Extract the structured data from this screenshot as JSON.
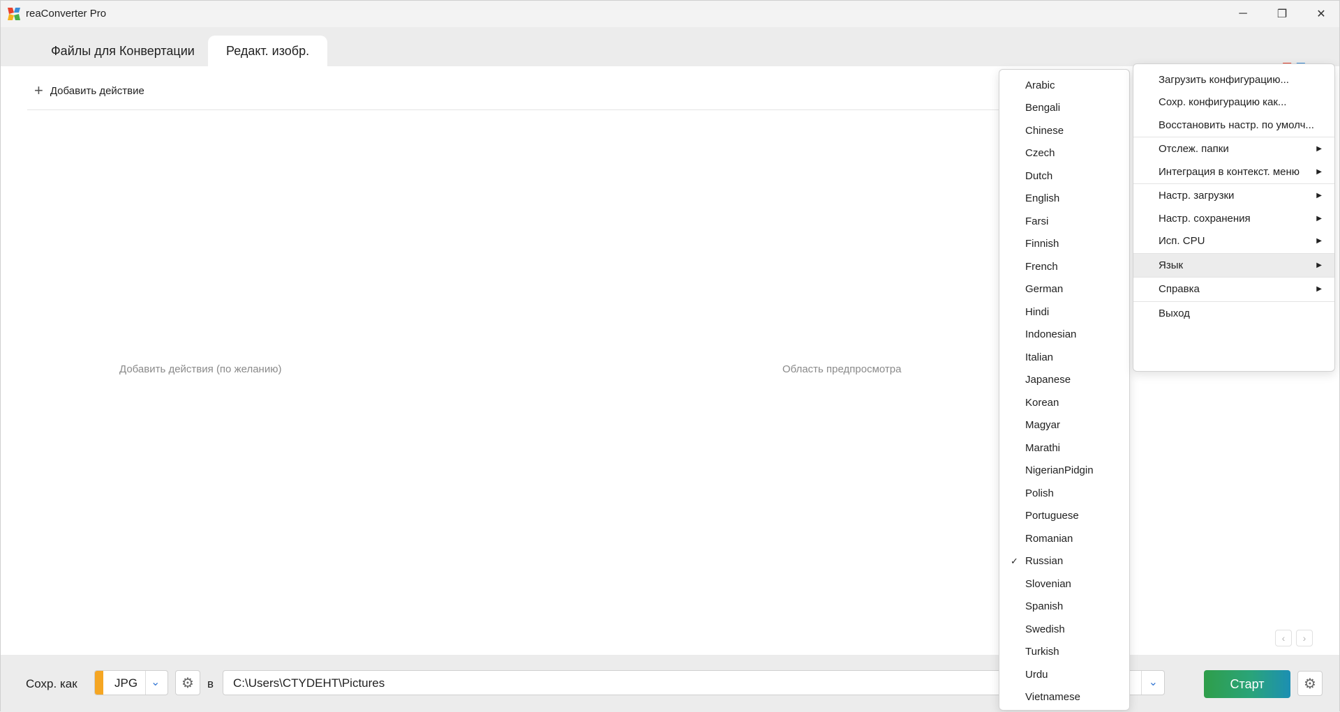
{
  "window": {
    "title": "reaConverter Pro",
    "minimize": "─",
    "maximize": "❐",
    "close": "✕"
  },
  "tabs": [
    {
      "label": "Файлы для Конвертации",
      "active": false
    },
    {
      "label": "Редакт. изобр.",
      "active": true
    }
  ],
  "main": {
    "add_action": "Добавить действие",
    "add_icon": "+",
    "actions_placeholder": "Добавить действия (по желанию)",
    "preview_placeholder": "Область предпросмотра",
    "prev_arrow": "‹",
    "next_arrow": "›"
  },
  "bottom": {
    "save_as_label": "Сохр. как",
    "format": "JPG",
    "format_color": "#f5a623",
    "dropdown_chevron": "⌄",
    "to_label": "в",
    "path": "C:\\Users\\CTYDEHT\\Pictures",
    "start": "Старт",
    "gear": "⚙"
  },
  "menu": {
    "items": [
      {
        "label": "Загрузить конфигурацию...",
        "submenu": false
      },
      {
        "label": "Сохр. конфигурацию как...",
        "submenu": false
      },
      {
        "label": "Восстановить настр. по умолч...",
        "submenu": false
      },
      {
        "label": "Отслеж. папки",
        "submenu": true
      },
      {
        "label": "Интеграция в контекст. меню",
        "submenu": true
      },
      {
        "label": "Настр. загрузки",
        "submenu": true
      },
      {
        "label": "Настр. сохранения",
        "submenu": true
      },
      {
        "label": "Исп. CPU",
        "submenu": true
      },
      {
        "label": "Язык",
        "submenu": true
      },
      {
        "label": "Справка",
        "submenu": true
      },
      {
        "label": "Выход",
        "submenu": false
      }
    ],
    "arrow": "▶"
  },
  "languages": {
    "selected": "Russian",
    "check": "✓",
    "items": [
      "Arabic",
      "Bengali",
      "Chinese",
      "Czech",
      "Dutch",
      "English",
      "Farsi",
      "Finnish",
      "French",
      "German",
      "Hindi",
      "Indonesian",
      "Italian",
      "Japanese",
      "Korean",
      "Magyar",
      "Marathi",
      "NigerianPidgin",
      "Polish",
      "Portuguese",
      "Romanian",
      "Russian",
      "Slovenian",
      "Spanish",
      "Swedish",
      "Turkish",
      "Urdu",
      "Vietnamese"
    ]
  },
  "colors": {
    "accent": "#3a7bd5",
    "start_gradient_start": "#2f9e4a",
    "start_gradient_end": "#1c8fb3"
  }
}
